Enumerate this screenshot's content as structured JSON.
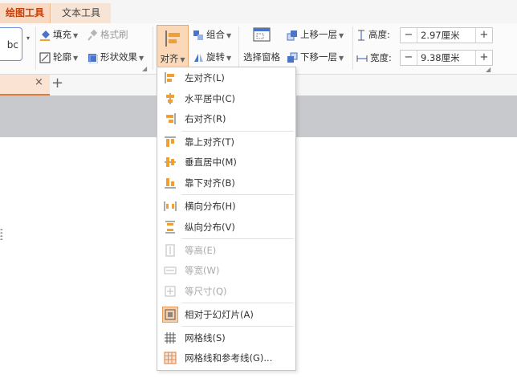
{
  "ribbon_tabs": [
    {
      "label": "绘图工具",
      "active": true
    },
    {
      "label": "文本工具",
      "active": false
    }
  ],
  "ribbon": {
    "style_preview": "bc",
    "fill_label": "填充",
    "format_painter_label": "格式刷",
    "outline_label": "轮廓",
    "shape_effect_label": "形状效果",
    "align_label": "对齐",
    "group_label": "组合",
    "rotate_label": "旋转",
    "selection_pane_label": "选择窗格",
    "bring_forward_label": "上移一层",
    "send_backward_label": "下移一层",
    "height_label": "高度:",
    "height_value": "2.97厘米",
    "width_label": "宽度:",
    "width_value": "9.38厘米",
    "minus": "−",
    "plus": "+"
  },
  "doc_tabs": {
    "close": "×",
    "add": "+"
  },
  "menu": {
    "items": [
      {
        "label": "左对齐(L)",
        "icon": "align-left-icon",
        "disabled": false
      },
      {
        "label": "水平居中(C)",
        "icon": "align-center-icon",
        "disabled": false
      },
      {
        "label": "右对齐(R)",
        "icon": "align-right-icon",
        "disabled": false
      },
      {
        "label": "靠上对齐(T)",
        "icon": "align-top-icon",
        "disabled": false
      },
      {
        "label": "垂直居中(M)",
        "icon": "align-middle-icon",
        "disabled": false
      },
      {
        "label": "靠下对齐(B)",
        "icon": "align-bottom-icon",
        "disabled": false
      },
      {
        "label": "横向分布(H)",
        "icon": "distribute-horizontal-icon",
        "disabled": false
      },
      {
        "label": "纵向分布(V)",
        "icon": "distribute-vertical-icon",
        "disabled": false
      },
      {
        "label": "等高(E)",
        "icon": "same-height-icon",
        "disabled": true
      },
      {
        "label": "等宽(W)",
        "icon": "same-width-icon",
        "disabled": true
      },
      {
        "label": "等尺寸(Q)",
        "icon": "same-size-icon",
        "disabled": true
      },
      {
        "label": "相对于幻灯片(A)",
        "icon": "relative-to-slide-icon",
        "disabled": false,
        "active": true
      },
      {
        "label": "网格线(S)",
        "icon": "gridlines-icon",
        "disabled": false
      },
      {
        "label": "网格线和参考线(G)...",
        "icon": "grid-guides-icon",
        "disabled": false
      }
    ]
  },
  "colors": {
    "accent": "#e07a3c",
    "active_tab_bg": "#f8d9c4",
    "highlight_bg": "#fbd9b8",
    "canvas_gray": "#c8c9cc"
  }
}
